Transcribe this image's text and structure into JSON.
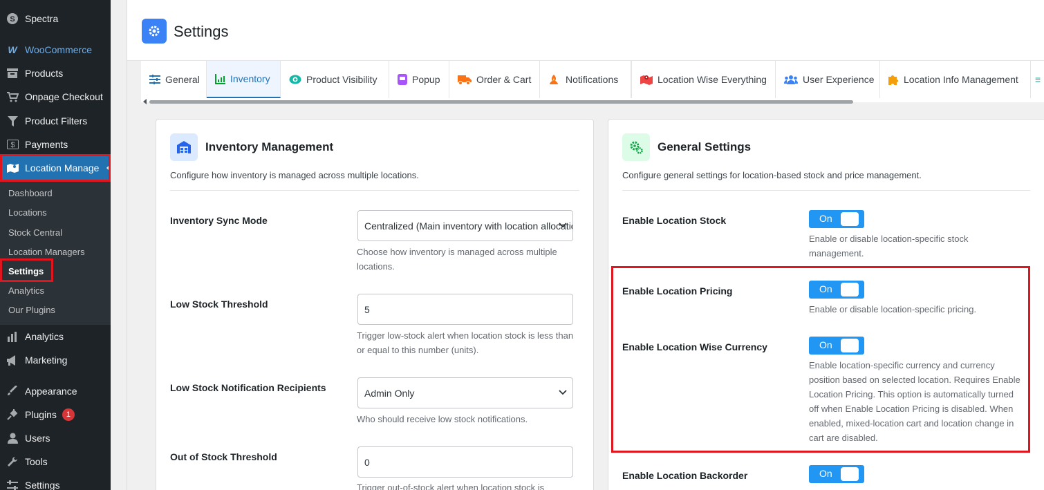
{
  "sidebar": {
    "items": [
      {
        "label": "Spectra",
        "icon": "spectra-icon"
      },
      {
        "label": "WooCommerce",
        "icon": "woo-icon"
      },
      {
        "label": "Products",
        "icon": "archive-icon"
      },
      {
        "label": "Onpage Checkout",
        "icon": "cart-icon"
      },
      {
        "label": "Product Filters",
        "icon": "funnel-icon"
      },
      {
        "label": "Payments",
        "icon": "dollar-icon"
      },
      {
        "label": "Location Manage",
        "icon": "map-icon"
      },
      {
        "label": "Analytics",
        "icon": "bar-chart-icon"
      },
      {
        "label": "Marketing",
        "icon": "megaphone-icon"
      },
      {
        "label": "Appearance",
        "icon": "brush-icon"
      },
      {
        "label": "Plugins",
        "icon": "plug-icon",
        "badge": "1"
      },
      {
        "label": "Users",
        "icon": "user-icon"
      },
      {
        "label": "Tools",
        "icon": "wrench-icon"
      },
      {
        "label": "Settings",
        "icon": "sliders-icon"
      }
    ],
    "submenu": [
      "Dashboard",
      "Locations",
      "Stock Central",
      "Location Managers",
      "Settings",
      "Analytics",
      "Our Plugins"
    ]
  },
  "header": {
    "title": "Settings"
  },
  "tabs": [
    {
      "label": "General",
      "icon": "sliders-icon"
    },
    {
      "label": "Inventory",
      "icon": "chart-icon"
    },
    {
      "label": "Product Visibility",
      "icon": "eye-icon"
    },
    {
      "label": "Popup",
      "icon": "popup-icon"
    },
    {
      "label": "Order & Cart",
      "icon": "truck-icon"
    },
    {
      "label": "Notifications",
      "icon": "bell-icon"
    },
    {
      "label": "Location Wise Everything",
      "icon": "map-icon"
    },
    {
      "label": "User Experience",
      "icon": "users-icon"
    },
    {
      "label": "Location Info Management",
      "icon": "puzzle-icon"
    }
  ],
  "inventory": {
    "title": "Inventory Management",
    "description": "Configure how inventory is managed across multiple locations.",
    "fields": [
      {
        "label": "Inventory Sync Mode",
        "value": "Centralized (Main inventory with location allocation)",
        "help": "Choose how inventory is managed across multiple locations.",
        "type": "select"
      },
      {
        "label": "Low Stock Threshold",
        "value": "5",
        "help": "Trigger low-stock alert when location stock is less than or equal to this number (units).",
        "type": "input"
      },
      {
        "label": "Low Stock Notification Recipients",
        "value": "Admin Only",
        "help": "Who should receive low stock notifications.",
        "type": "select"
      },
      {
        "label": "Out of Stock Threshold",
        "value": "0",
        "help": "Trigger out-of-stock alert when location stock is",
        "type": "input"
      }
    ]
  },
  "general": {
    "title": "General Settings",
    "description": "Configure general settings for location-based stock and price management.",
    "settings": [
      {
        "label": "Enable Location Stock",
        "state": "On",
        "help": "Enable or disable location-specific stock management."
      },
      {
        "label": "Enable Location Pricing",
        "state": "On",
        "help": "Enable or disable location-specific pricing."
      },
      {
        "label": "Enable Location Wise Currency",
        "state": "On",
        "help": "Enable location-specific currency and currency position based on selected location. Requires Enable Location Pricing. This option is automatically turned off when Enable Location Pricing is disabled. When enabled, mixed-location cart and location change in cart are disabled."
      },
      {
        "label": "Enable Location Backorder",
        "state": "On",
        "help": ""
      }
    ]
  },
  "colors": {
    "accent": "#2271b1",
    "toggle": "#2196f3",
    "highlight": "#e0151d",
    "sidebar": "#1d2327"
  }
}
